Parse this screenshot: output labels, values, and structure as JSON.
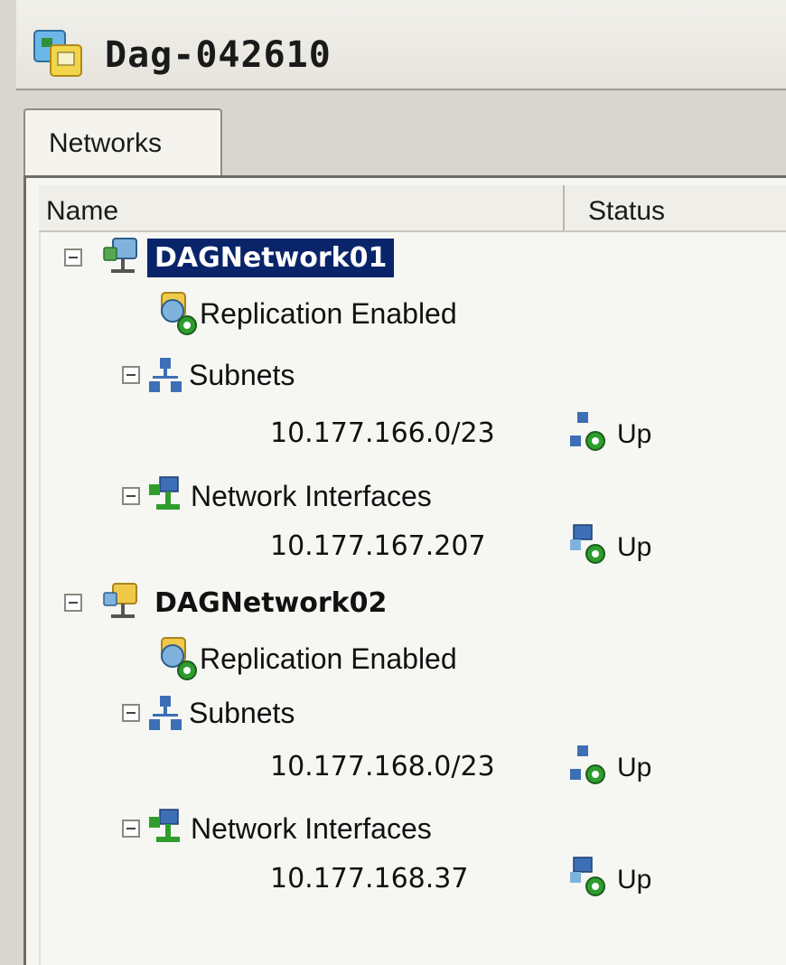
{
  "window": {
    "title": "Dag-042610",
    "title_icon": "dag-icon"
  },
  "tabs": [
    {
      "label": "Networks",
      "selected": true
    }
  ],
  "columns": {
    "name": "Name",
    "status": "Status"
  },
  "networks": [
    {
      "name": "DAGNetwork01",
      "selected": true,
      "icon": "network-icon",
      "replication": "Replication Enabled",
      "subnets_label": "Subnets",
      "subnet": {
        "value": "10.177.166.0/23",
        "status": "Up"
      },
      "interfaces_label": "Network Interfaces",
      "interface": {
        "value": "10.177.167.207",
        "status": "Up"
      }
    },
    {
      "name": "DAGNetwork02",
      "selected": false,
      "icon": "network-icon",
      "replication": "Replication Enabled",
      "subnets_label": "Subnets",
      "subnet": {
        "value": "10.177.168.0/23",
        "status": "Up"
      },
      "interfaces_label": "Network Interfaces",
      "interface": {
        "value": "10.177.168.37",
        "status": "Up"
      }
    }
  ],
  "colors": {
    "selection": "#0a246a",
    "status_ok": "#2e9d2e"
  }
}
